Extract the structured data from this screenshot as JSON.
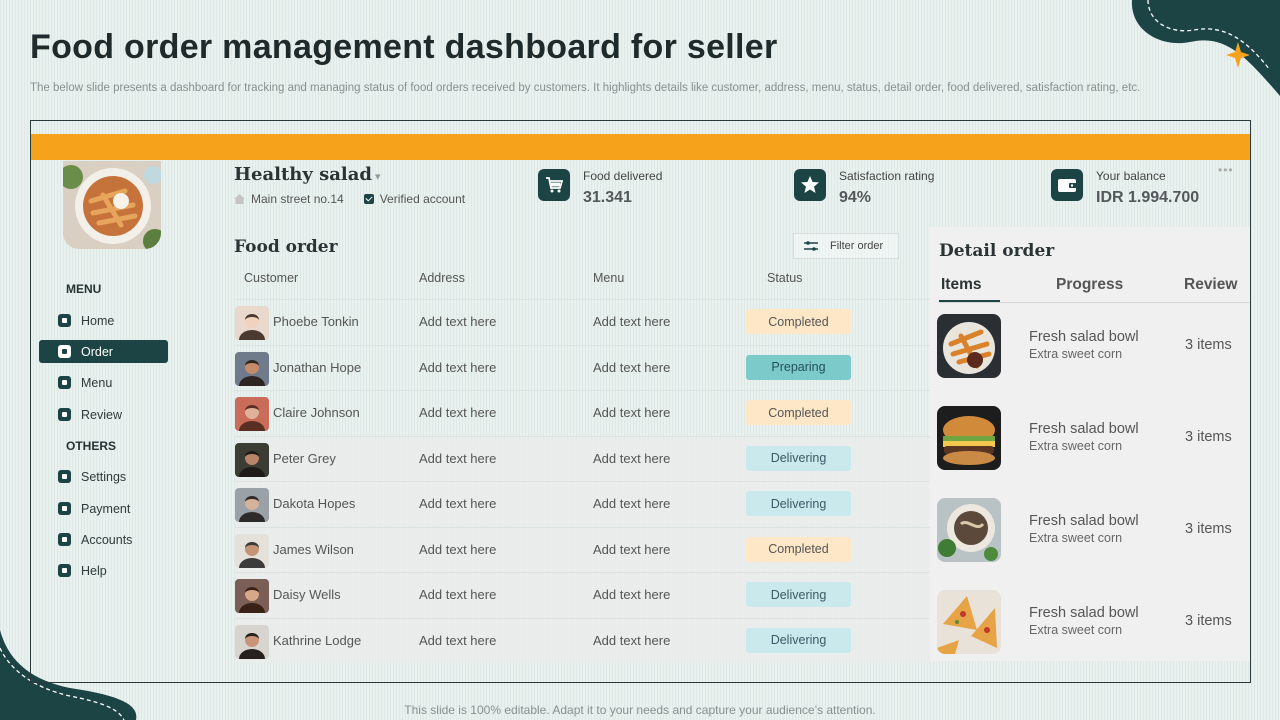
{
  "page": {
    "title": "Food order management dashboard for seller",
    "subtitle": "The below slide presents a dashboard for tracking and managing status of food orders received by customers. It highlights details like customer, address, menu, status, detail order, food delivered, satisfaction rating, etc.",
    "footer": "This slide is 100% editable. Adapt it to your needs and capture your audience’s attention."
  },
  "colors": {
    "accent": "#f7a21b",
    "primary": "#1d4445"
  },
  "store": {
    "name": "Healthy salad",
    "address": "Main street no.14",
    "verified": "Verified account"
  },
  "sidebar": {
    "menu_heading": "MENU",
    "menu_items": [
      {
        "label": "Home",
        "icon": "home-icon"
      },
      {
        "label": "Order",
        "icon": "cart-icon",
        "active": true
      },
      {
        "label": "Menu",
        "icon": "menu-icon"
      },
      {
        "label": "Review",
        "icon": "review-icon"
      }
    ],
    "others_heading": "OTHERS",
    "other_items": [
      {
        "label": "Settings",
        "icon": "gear-icon"
      },
      {
        "label": "Payment",
        "icon": "card-icon"
      },
      {
        "label": "Accounts",
        "icon": "user-icon"
      },
      {
        "label": "Help",
        "icon": "help-icon"
      }
    ]
  },
  "stats": [
    {
      "label": "Food delivered",
      "value": "31.341",
      "icon": "cart-icon"
    },
    {
      "label": "Satisfaction rating",
      "value": "94%",
      "icon": "star-icon"
    },
    {
      "label": "Your balance",
      "value": "IDR 1.994.700",
      "icon": "wallet-icon"
    }
  ],
  "food_order": {
    "title": "Food order",
    "filter_label": "Filter order",
    "columns": [
      "Customer",
      "Address",
      "Menu",
      "Status"
    ],
    "rows": [
      {
        "customer": "Phoebe Tonkin",
        "address": "Add text here",
        "menu": "Add text here",
        "status": "Completed"
      },
      {
        "customer": "Jonathan Hope",
        "address": "Add text here",
        "menu": "Add text here",
        "status": "Preparing"
      },
      {
        "customer": "Claire Johnson",
        "address": "Add text here",
        "menu": "Add text here",
        "status": "Completed"
      },
      {
        "customer": "Peter Grey",
        "address": "Add text here",
        "menu": "Add text here",
        "status": "Delivering"
      },
      {
        "customer": "Dakota Hopes",
        "address": "Add text here",
        "menu": "Add text here",
        "status": "Delivering"
      },
      {
        "customer": "James Wilson",
        "address": "Add text here",
        "menu": "Add text here",
        "status": "Completed"
      },
      {
        "customer": "Daisy Wells",
        "address": "Add text here",
        "menu": "Add text here",
        "status": "Delivering"
      },
      {
        "customer": "Kathrine Lodge",
        "address": "Add text here",
        "menu": "Add text here",
        "status": "Delivering"
      }
    ],
    "status_colors": {
      "Completed": {
        "bg": "#fde7c6",
        "fg": "#555555"
      },
      "Preparing": {
        "bg": "#7ccbca",
        "fg": "#24505a"
      },
      "Delivering": {
        "bg": "#c9e9ec",
        "fg": "#3a5a64"
      }
    }
  },
  "detail_order": {
    "title": "Detail order",
    "tabs": [
      "Items",
      "Progress",
      "Review"
    ],
    "items": [
      {
        "name": "Fresh salad bowl",
        "sub": "Extra sweet corn",
        "count": "3 items",
        "photo": "fries"
      },
      {
        "name": "Fresh salad bowl",
        "sub": "Extra sweet corn",
        "count": "3 items",
        "photo": "burger"
      },
      {
        "name": "Fresh salad bowl",
        "sub": "Extra sweet corn",
        "count": "3 items",
        "photo": "bowl"
      },
      {
        "name": "Fresh salad bowl",
        "sub": "Extra sweet corn",
        "count": "3 items",
        "photo": "pizza"
      }
    ]
  }
}
